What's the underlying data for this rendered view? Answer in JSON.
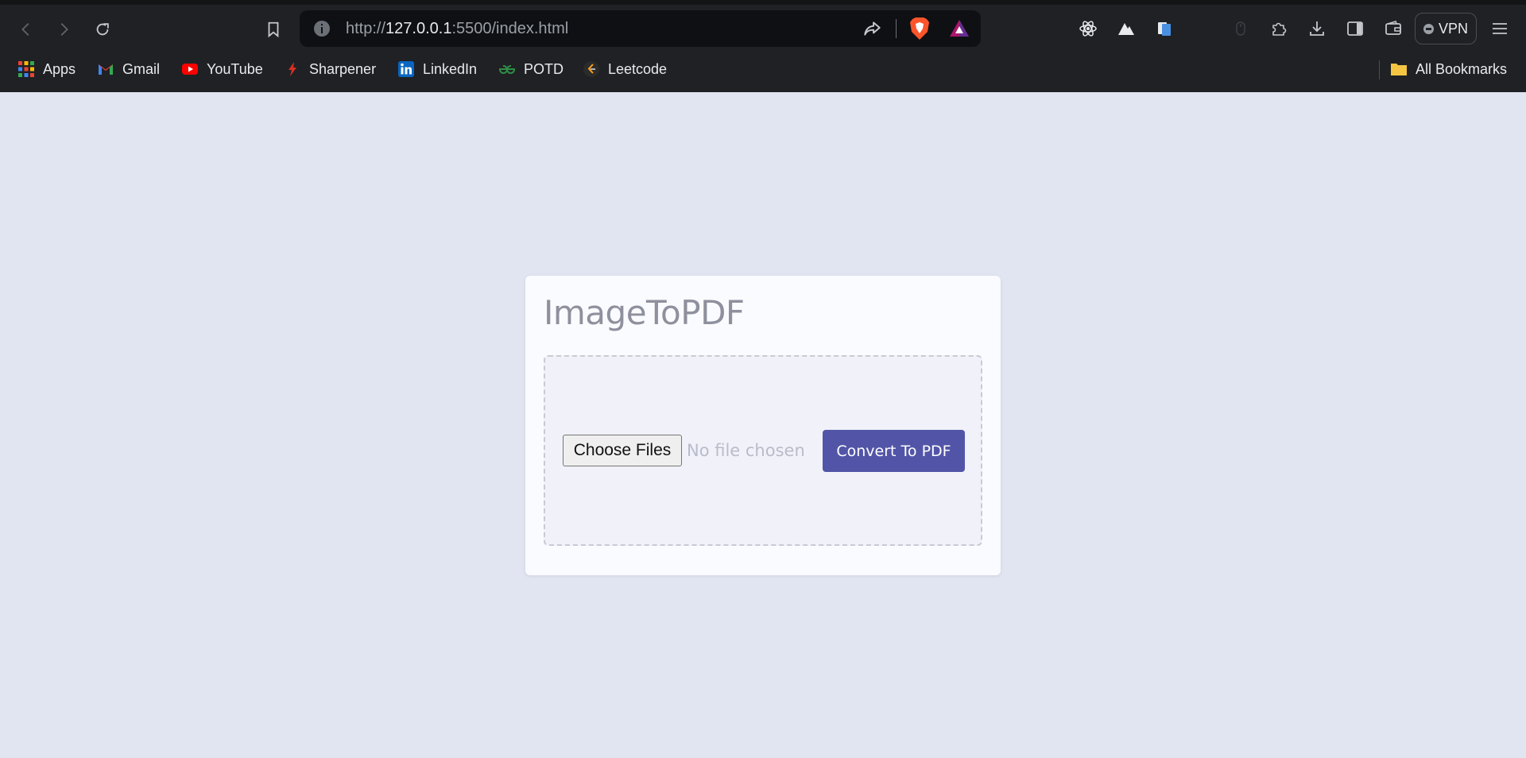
{
  "browser": {
    "url": {
      "scheme": "http://",
      "host": "127.0.0.1",
      "rest": ":5500/index.html"
    },
    "vpn_label": "VPN",
    "bookmarks": [
      {
        "label": "Apps",
        "icon": "apps-grid-icon"
      },
      {
        "label": "Gmail",
        "icon": "gmail-icon"
      },
      {
        "label": "YouTube",
        "icon": "youtube-icon"
      },
      {
        "label": "Sharpener",
        "icon": "sharpener-icon"
      },
      {
        "label": "LinkedIn",
        "icon": "linkedin-icon"
      },
      {
        "label": "POTD",
        "icon": "geeksforgeeks-icon"
      },
      {
        "label": "Leetcode",
        "icon": "leetcode-icon"
      }
    ],
    "all_bookmarks_label": "All Bookmarks",
    "colors": {
      "chrome_bg": "#202124",
      "omnibox_bg": "#0f1013",
      "brave_orange": "#fb542b"
    }
  },
  "page": {
    "title": "ImageToPDF",
    "file_input": {
      "button_label": "Choose Files",
      "status": "No file chosen"
    },
    "convert_button_label": "Convert To PDF",
    "colors": {
      "background": "#e1e4f1",
      "card": "#fafbfe",
      "accent": "#5255a7",
      "title": "#8e909d"
    }
  }
}
